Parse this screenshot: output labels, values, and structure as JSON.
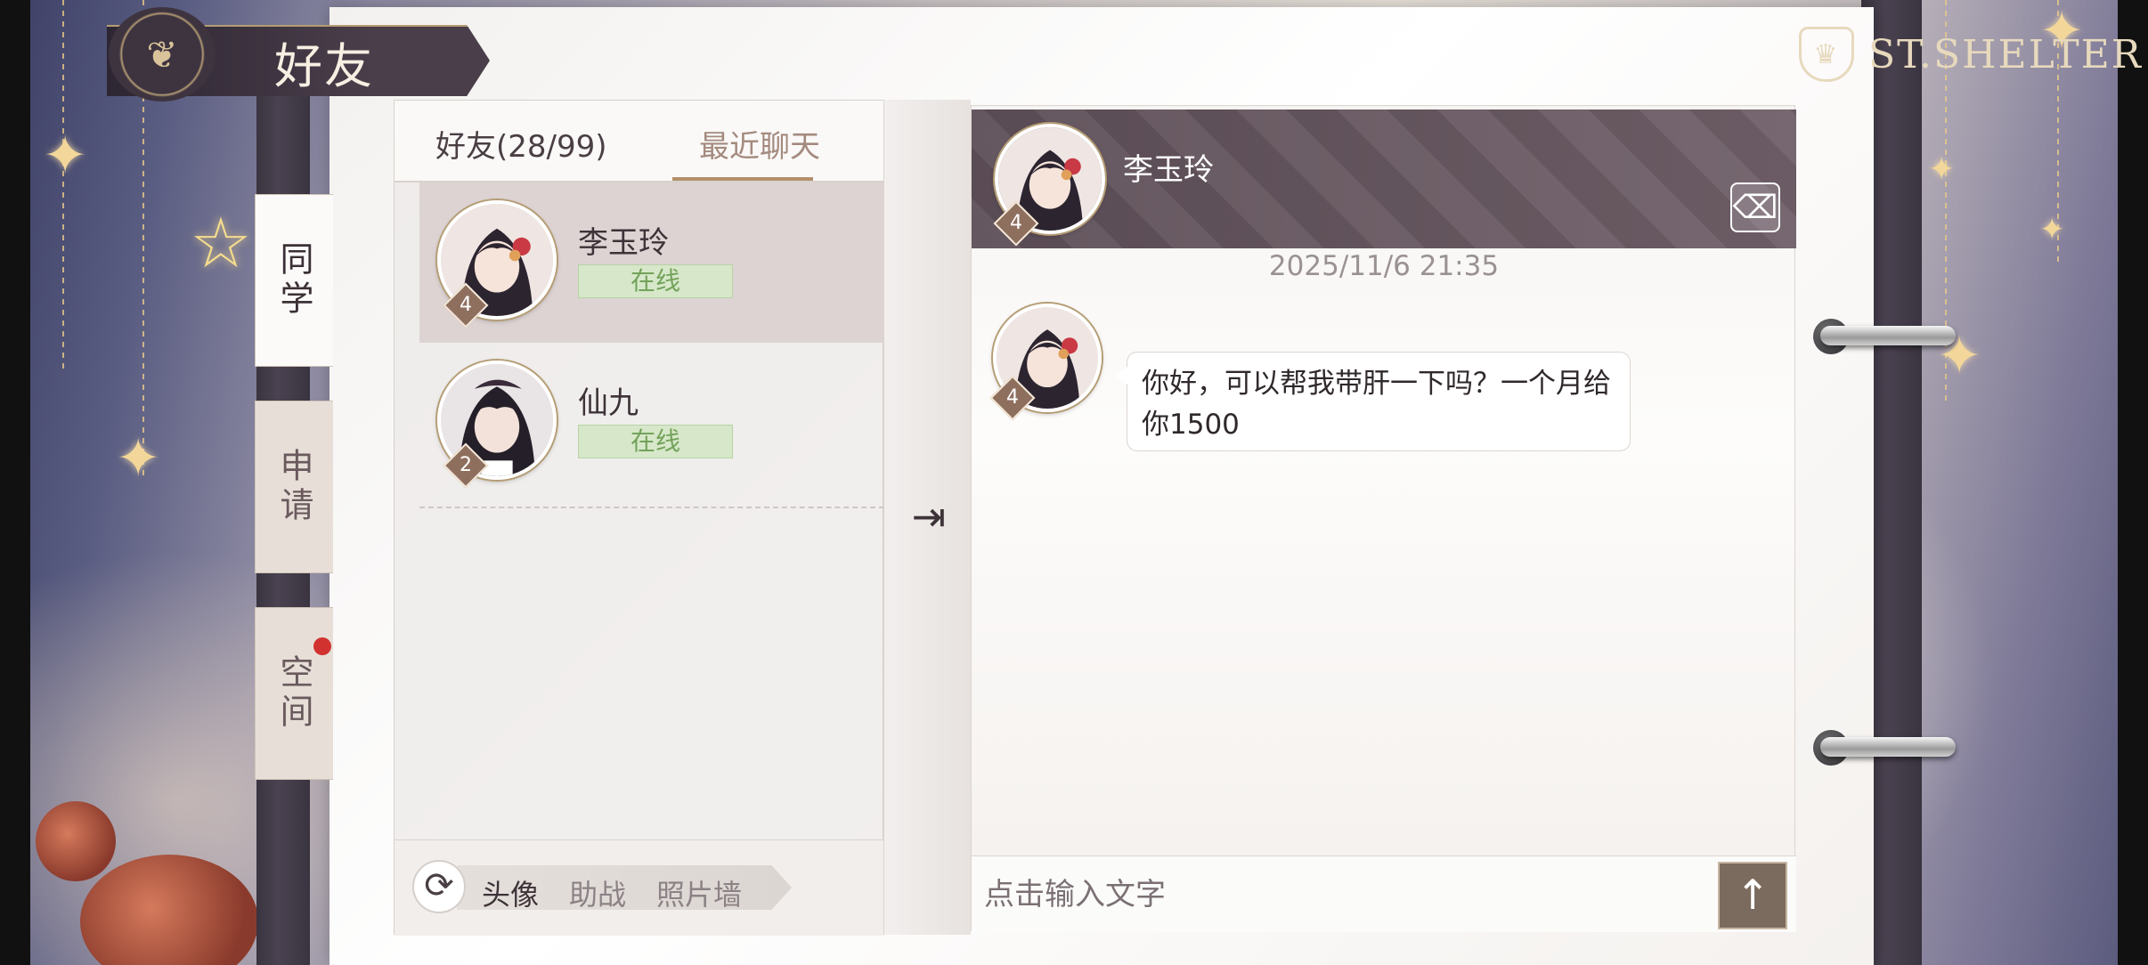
{
  "header": {
    "title": "好友",
    "brand": "ST.SHELTER"
  },
  "side_tabs": [
    {
      "label": "同学",
      "active": true
    },
    {
      "label": "申请",
      "active": false
    },
    {
      "label": "空间",
      "active": false,
      "has_notification": true
    }
  ],
  "friend_list": {
    "tabs": {
      "friends": "好友(28/99)",
      "recent": "最近聊天"
    },
    "friends": [
      {
        "name": "李玉玲",
        "level": "4",
        "status": "在线",
        "selected": true
      },
      {
        "name": "仙九",
        "level": "2",
        "status": "在线",
        "selected": false
      }
    ],
    "footer_tabs": [
      "头像",
      "助战",
      "照片墙"
    ]
  },
  "chat": {
    "partner_name": "李玉玲",
    "partner_level": "4",
    "timestamp": "2025/11/6  21:35",
    "messages": [
      {
        "from": "李玉玲",
        "level": "4",
        "text": "你好，可以帮我带肝一下吗？一个月给你1500"
      }
    ],
    "input_placeholder": "点击输入文字"
  },
  "icons": {
    "title_emblem": "butterfly-icon",
    "refresh": "refresh-icon",
    "collapse": "collapse-list-icon",
    "clear": "clear-broom-icon",
    "send": "arrow-up-icon"
  },
  "colors": {
    "status_online_bg": "#d6e8c9",
    "status_online_text": "#73a25a",
    "header_bg": "#5d4e57",
    "send_button": "#7b6b5e",
    "notification_dot": "#d13230"
  }
}
